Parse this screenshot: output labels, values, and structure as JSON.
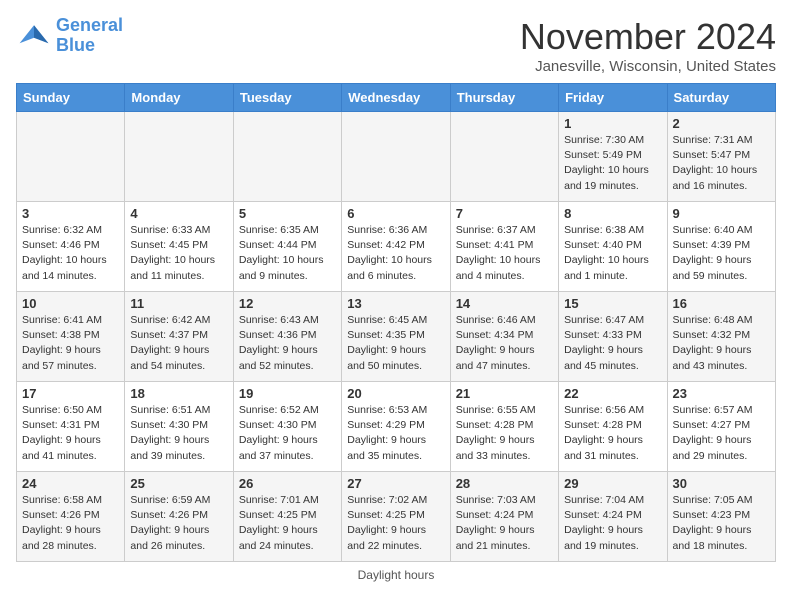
{
  "logo": {
    "line1": "General",
    "line2": "Blue"
  },
  "title": "November 2024",
  "location": "Janesville, Wisconsin, United States",
  "days_of_week": [
    "Sunday",
    "Monday",
    "Tuesday",
    "Wednesday",
    "Thursday",
    "Friday",
    "Saturday"
  ],
  "weeks": [
    [
      {
        "day": "",
        "info": ""
      },
      {
        "day": "",
        "info": ""
      },
      {
        "day": "",
        "info": ""
      },
      {
        "day": "",
        "info": ""
      },
      {
        "day": "",
        "info": ""
      },
      {
        "day": "1",
        "info": "Sunrise: 7:30 AM\nSunset: 5:49 PM\nDaylight: 10 hours\nand 19 minutes."
      },
      {
        "day": "2",
        "info": "Sunrise: 7:31 AM\nSunset: 5:47 PM\nDaylight: 10 hours\nand 16 minutes."
      }
    ],
    [
      {
        "day": "3",
        "info": "Sunrise: 6:32 AM\nSunset: 4:46 PM\nDaylight: 10 hours\nand 14 minutes."
      },
      {
        "day": "4",
        "info": "Sunrise: 6:33 AM\nSunset: 4:45 PM\nDaylight: 10 hours\nand 11 minutes."
      },
      {
        "day": "5",
        "info": "Sunrise: 6:35 AM\nSunset: 4:44 PM\nDaylight: 10 hours\nand 9 minutes."
      },
      {
        "day": "6",
        "info": "Sunrise: 6:36 AM\nSunset: 4:42 PM\nDaylight: 10 hours\nand 6 minutes."
      },
      {
        "day": "7",
        "info": "Sunrise: 6:37 AM\nSunset: 4:41 PM\nDaylight: 10 hours\nand 4 minutes."
      },
      {
        "day": "8",
        "info": "Sunrise: 6:38 AM\nSunset: 4:40 PM\nDaylight: 10 hours\nand 1 minute."
      },
      {
        "day": "9",
        "info": "Sunrise: 6:40 AM\nSunset: 4:39 PM\nDaylight: 9 hours\nand 59 minutes."
      }
    ],
    [
      {
        "day": "10",
        "info": "Sunrise: 6:41 AM\nSunset: 4:38 PM\nDaylight: 9 hours\nand 57 minutes."
      },
      {
        "day": "11",
        "info": "Sunrise: 6:42 AM\nSunset: 4:37 PM\nDaylight: 9 hours\nand 54 minutes."
      },
      {
        "day": "12",
        "info": "Sunrise: 6:43 AM\nSunset: 4:36 PM\nDaylight: 9 hours\nand 52 minutes."
      },
      {
        "day": "13",
        "info": "Sunrise: 6:45 AM\nSunset: 4:35 PM\nDaylight: 9 hours\nand 50 minutes."
      },
      {
        "day": "14",
        "info": "Sunrise: 6:46 AM\nSunset: 4:34 PM\nDaylight: 9 hours\nand 47 minutes."
      },
      {
        "day": "15",
        "info": "Sunrise: 6:47 AM\nSunset: 4:33 PM\nDaylight: 9 hours\nand 45 minutes."
      },
      {
        "day": "16",
        "info": "Sunrise: 6:48 AM\nSunset: 4:32 PM\nDaylight: 9 hours\nand 43 minutes."
      }
    ],
    [
      {
        "day": "17",
        "info": "Sunrise: 6:50 AM\nSunset: 4:31 PM\nDaylight: 9 hours\nand 41 minutes."
      },
      {
        "day": "18",
        "info": "Sunrise: 6:51 AM\nSunset: 4:30 PM\nDaylight: 9 hours\nand 39 minutes."
      },
      {
        "day": "19",
        "info": "Sunrise: 6:52 AM\nSunset: 4:30 PM\nDaylight: 9 hours\nand 37 minutes."
      },
      {
        "day": "20",
        "info": "Sunrise: 6:53 AM\nSunset: 4:29 PM\nDaylight: 9 hours\nand 35 minutes."
      },
      {
        "day": "21",
        "info": "Sunrise: 6:55 AM\nSunset: 4:28 PM\nDaylight: 9 hours\nand 33 minutes."
      },
      {
        "day": "22",
        "info": "Sunrise: 6:56 AM\nSunset: 4:28 PM\nDaylight: 9 hours\nand 31 minutes."
      },
      {
        "day": "23",
        "info": "Sunrise: 6:57 AM\nSunset: 4:27 PM\nDaylight: 9 hours\nand 29 minutes."
      }
    ],
    [
      {
        "day": "24",
        "info": "Sunrise: 6:58 AM\nSunset: 4:26 PM\nDaylight: 9 hours\nand 28 minutes."
      },
      {
        "day": "25",
        "info": "Sunrise: 6:59 AM\nSunset: 4:26 PM\nDaylight: 9 hours\nand 26 minutes."
      },
      {
        "day": "26",
        "info": "Sunrise: 7:01 AM\nSunset: 4:25 PM\nDaylight: 9 hours\nand 24 minutes."
      },
      {
        "day": "27",
        "info": "Sunrise: 7:02 AM\nSunset: 4:25 PM\nDaylight: 9 hours\nand 22 minutes."
      },
      {
        "day": "28",
        "info": "Sunrise: 7:03 AM\nSunset: 4:24 PM\nDaylight: 9 hours\nand 21 minutes."
      },
      {
        "day": "29",
        "info": "Sunrise: 7:04 AM\nSunset: 4:24 PM\nDaylight: 9 hours\nand 19 minutes."
      },
      {
        "day": "30",
        "info": "Sunrise: 7:05 AM\nSunset: 4:23 PM\nDaylight: 9 hours\nand 18 minutes."
      }
    ]
  ],
  "footer": "Daylight hours"
}
